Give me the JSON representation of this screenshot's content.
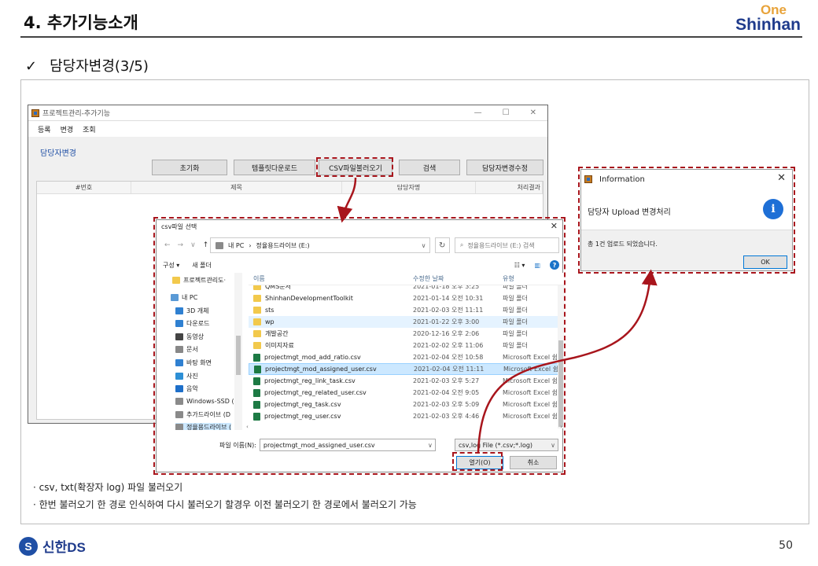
{
  "slide": {
    "title": "4. 추가기능소개",
    "logo_top": "One",
    "logo_main": "Shinhan",
    "section_check": "✓",
    "section_title": "담당자변경(3/5)",
    "notes": [
      "· csv, txt(확장자 log) 파일 불러오기",
      "· 한번 불러오기 한 경로 인식하여 다시 불러오기 할경우 이전 불러오기 한 경로에서 불러오기 가능"
    ],
    "footer_brand": "신한DS",
    "footer_mark": "S",
    "page_number": "50",
    "highlight_color": "#a8151c"
  },
  "app_window": {
    "title": "프로젝트관리-추가기능",
    "window_controls": [
      "—",
      "☐",
      "✕"
    ],
    "menu": [
      "등록",
      "변경",
      "조회"
    ],
    "subtitle": "담당자변경",
    "buttons": [
      "초기화",
      "템플릿다운로드",
      "CSV파일불러오기",
      "검색",
      "담당자변경수정"
    ],
    "columns": [
      "#번호",
      "제목",
      "담당자명",
      "처리결과"
    ]
  },
  "file_dialog": {
    "title": "csv파일 선택",
    "close": "✕",
    "nav_arrows": [
      "←",
      "→",
      "∨",
      "↑"
    ],
    "path": [
      "내 PC",
      "›",
      "정율용드라이브 (E:)"
    ],
    "search_placeholder": "정율용드라이브 (E:) 검색",
    "toolbar_organize": "구성 ▾",
    "toolbar_new_folder": "새 폴더",
    "toolbar_view": "☷ ▾",
    "toolbar_pane": "▥",
    "help": "?",
    "nav_items": [
      {
        "label": "프로젝트관리도·",
        "icon": "folder-icon"
      },
      {
        "label": "내 PC",
        "icon": "pc-icon"
      },
      {
        "label": "3D 개체",
        "icon": "3d-objects-icon"
      },
      {
        "label": "다운로드",
        "icon": "download-icon"
      },
      {
        "label": "동영상",
        "icon": "video-icon"
      },
      {
        "label": "문서",
        "icon": "document-icon"
      },
      {
        "label": "바탕 화면",
        "icon": "desktop-icon"
      },
      {
        "label": "사진",
        "icon": "picture-icon"
      },
      {
        "label": "음악",
        "icon": "music-icon"
      },
      {
        "label": "Windows-SSD (C",
        "icon": "drive-icon"
      },
      {
        "label": "추가드라이브 (D",
        "icon": "drive-icon"
      },
      {
        "label": "정율용드라이브 (",
        "icon": "drive-icon"
      }
    ],
    "columns": [
      "이름",
      "수정한 날짜",
      "유형"
    ],
    "files": [
      {
        "name": "QMS문서",
        "date": "2021-01-18 오후 3:25",
        "type": "파일 폴더",
        "kind": "folder"
      },
      {
        "name": "ShinhanDevelopmentToolkit",
        "date": "2021-01-14 오전 10:31",
        "type": "파일 폴더",
        "kind": "folder"
      },
      {
        "name": "sts",
        "date": "2021-02-03 오전 11:11",
        "type": "파일 폴더",
        "kind": "folder"
      },
      {
        "name": "wp",
        "date": "2021-01-22 오후 3:00",
        "type": "파일 폴더",
        "kind": "folder"
      },
      {
        "name": "개발공간",
        "date": "2020-12-16 오후 2:06",
        "type": "파일 폴더",
        "kind": "folder"
      },
      {
        "name": "이미지자료",
        "date": "2021-02-02 오후 11:06",
        "type": "파일 폴더",
        "kind": "folder"
      },
      {
        "name": "projectmgt_mod_add_ratio.csv",
        "date": "2021-02-04 오전 10:58",
        "type": "Microsoft Excel 쉼표",
        "kind": "csv"
      },
      {
        "name": "projectmgt_mod_assigned_user.csv",
        "date": "2021-02-04 오전 11:11",
        "type": "Microsoft Excel 쉼표",
        "kind": "csv"
      },
      {
        "name": "projectmgt_reg_link_task.csv",
        "date": "2021-02-03 오후 5:27",
        "type": "Microsoft Excel 쉼표",
        "kind": "csv"
      },
      {
        "name": "projectmgt_reg_related_user.csv",
        "date": "2021-02-04 오전 9:05",
        "type": "Microsoft Excel 쉼표",
        "kind": "csv"
      },
      {
        "name": "projectmgt_reg_task.csv",
        "date": "2021-02-03 오후 5:09",
        "type": "Microsoft Excel 쉼표",
        "kind": "csv"
      },
      {
        "name": "projectmgt_reg_user.csv",
        "date": "2021-02-03 오후 4:46",
        "type": "Microsoft Excel 쉼표",
        "kind": "csv"
      }
    ],
    "hscroll_left": "‹",
    "hscroll_right": "›",
    "filename_label": "파일 이름(N):",
    "filename_value": "projectmgt_mod_assigned_user.csv",
    "filter_value": "csv,log File (*.csv;*.log)",
    "open_label": "열기(O)",
    "cancel_label": "취소"
  },
  "info_dialog": {
    "title": "Information",
    "close": "✕",
    "heading": "담당자 Upload 변경처리",
    "icon_glyph": "i",
    "message": "총 1건 업로드 되었습니다.",
    "ok_label": "OK"
  }
}
